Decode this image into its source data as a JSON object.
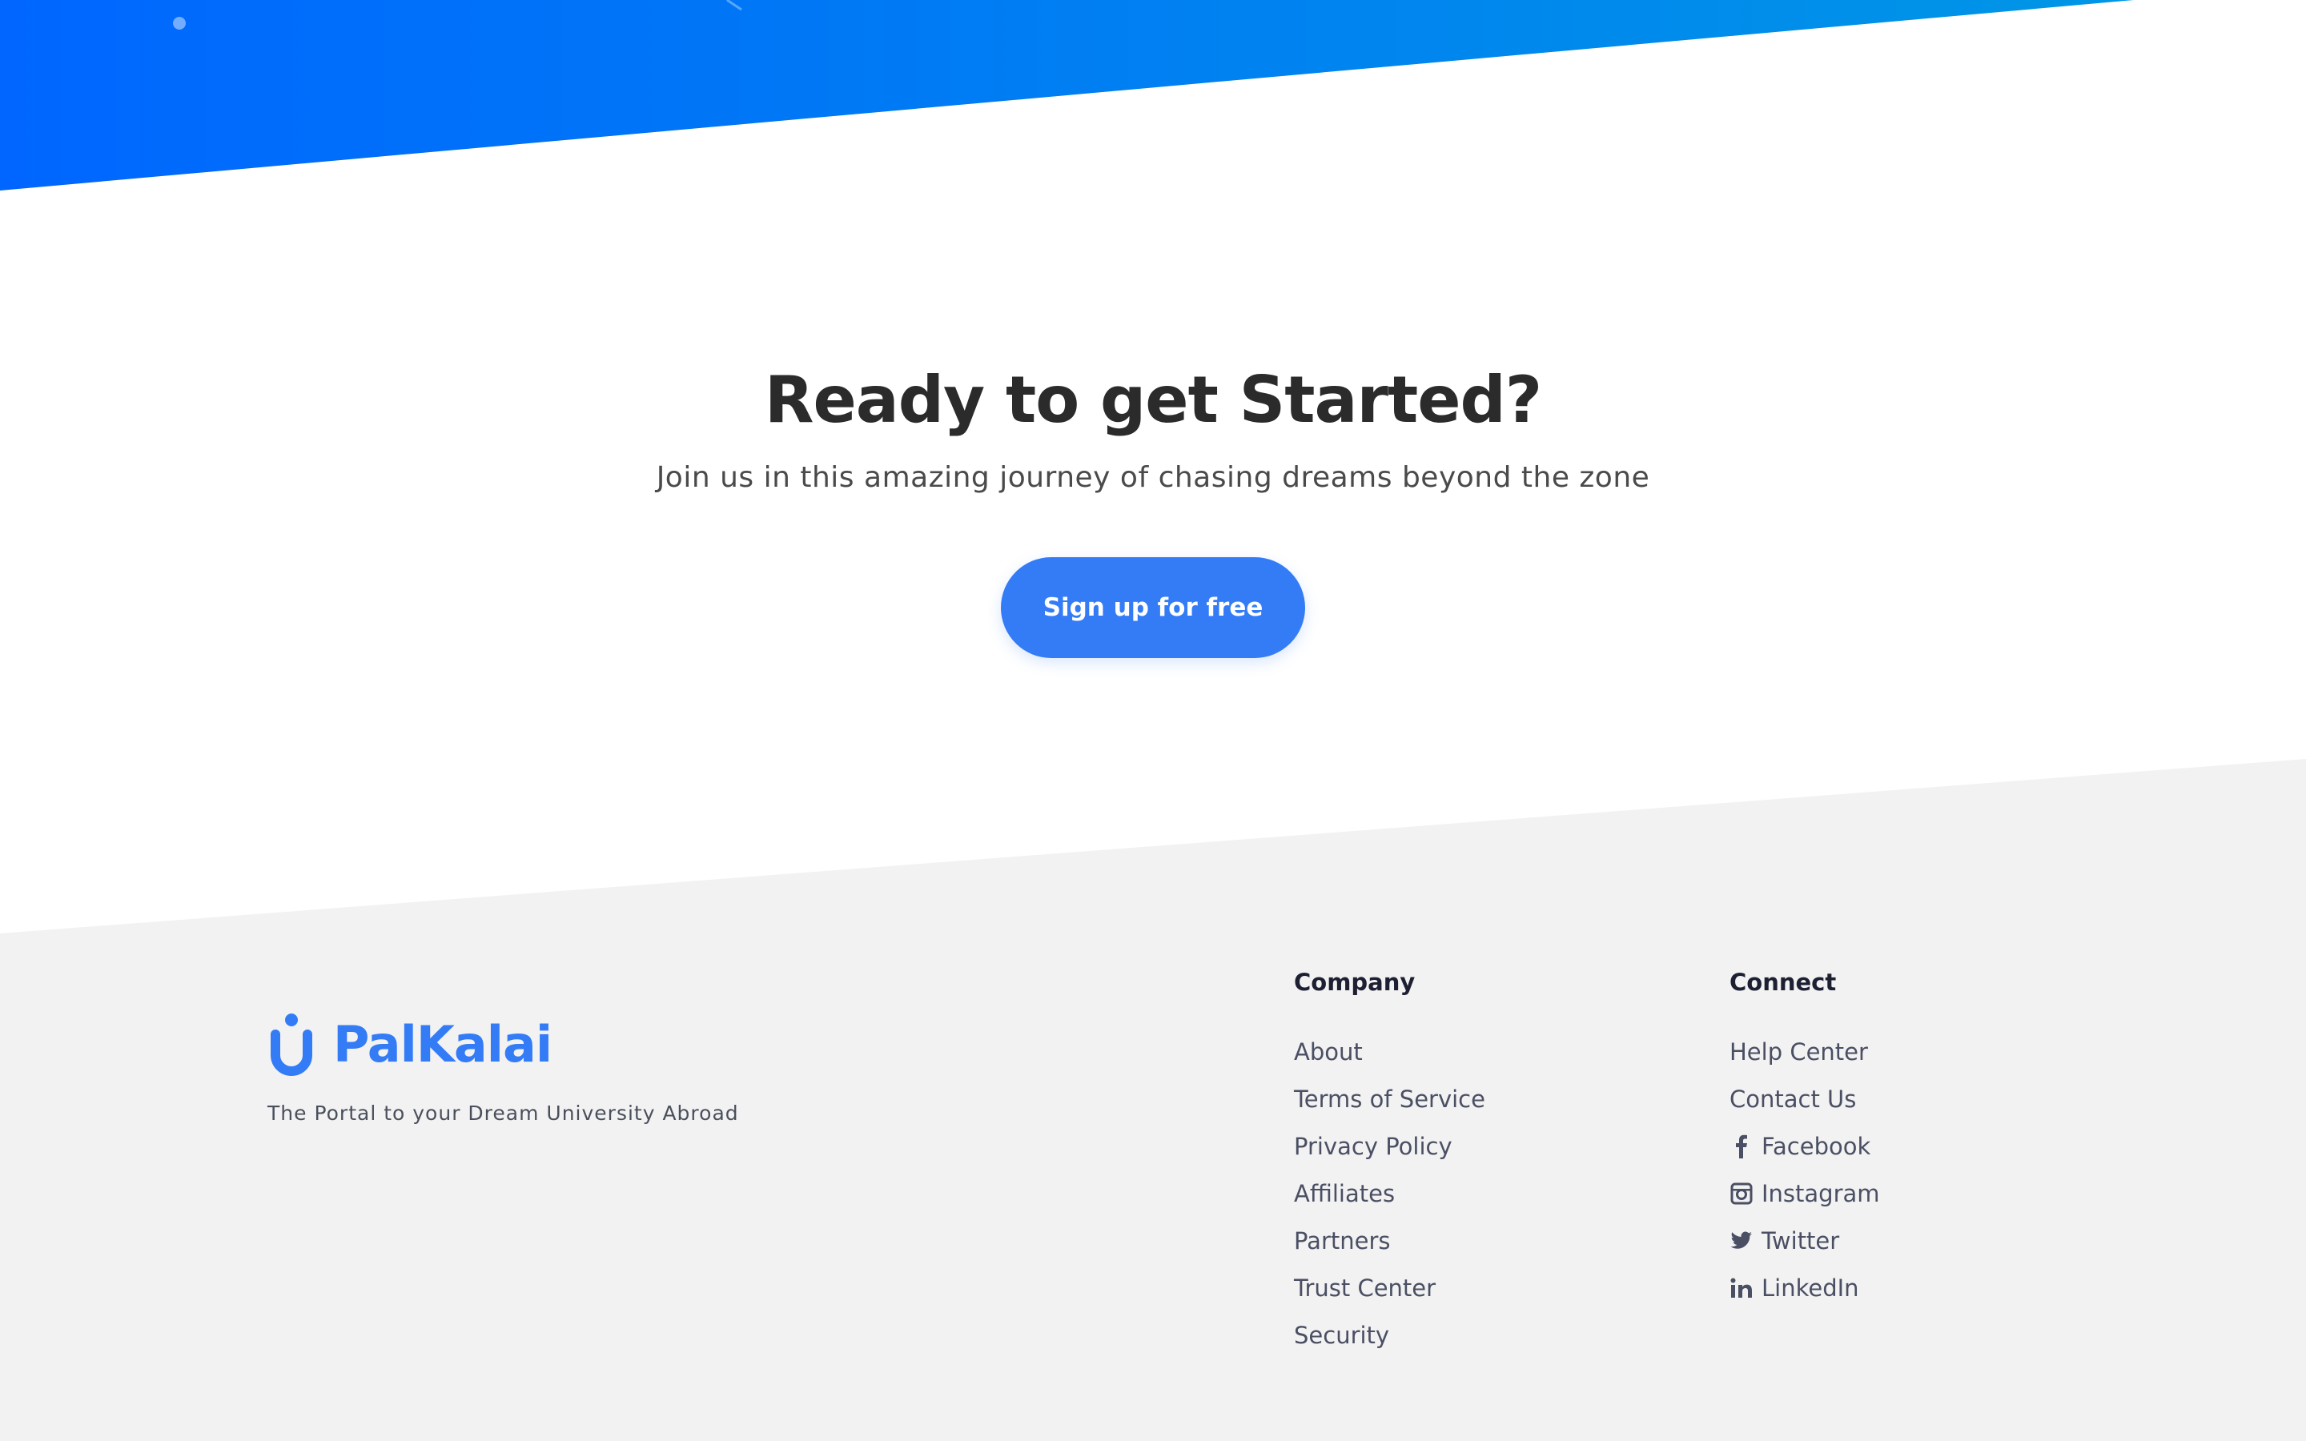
{
  "cta": {
    "title": "Ready to get Started?",
    "subtitle": "Join us in this amazing journey of chasing dreams beyond the zone",
    "button_label": "Sign up for free"
  },
  "brand": {
    "name": "PalKalai",
    "tagline": "The Portal to your Dream University Abroad"
  },
  "footer": {
    "company": {
      "heading": "Company",
      "links": [
        "About",
        "Terms of Service",
        "Privacy Policy",
        "Affiliates",
        "Partners",
        "Trust Center",
        "Security"
      ]
    },
    "connect": {
      "heading": "Connect",
      "links": [
        {
          "label": "Help Center",
          "icon": ""
        },
        {
          "label": "Contact Us",
          "icon": ""
        },
        {
          "label": "Facebook",
          "icon": "facebook-icon"
        },
        {
          "label": "Instagram",
          "icon": "instagram-icon"
        },
        {
          "label": "Twitter",
          "icon": "twitter-icon"
        },
        {
          "label": "LinkedIn",
          "icon": "linkedin-icon"
        }
      ]
    }
  },
  "colors": {
    "brand_blue": "#347cf6",
    "band_blue_start": "#0066ff",
    "band_blue_end": "#0096e6",
    "footer_bg": "#f2f2f2",
    "heading_text": "#2b2b2b"
  }
}
